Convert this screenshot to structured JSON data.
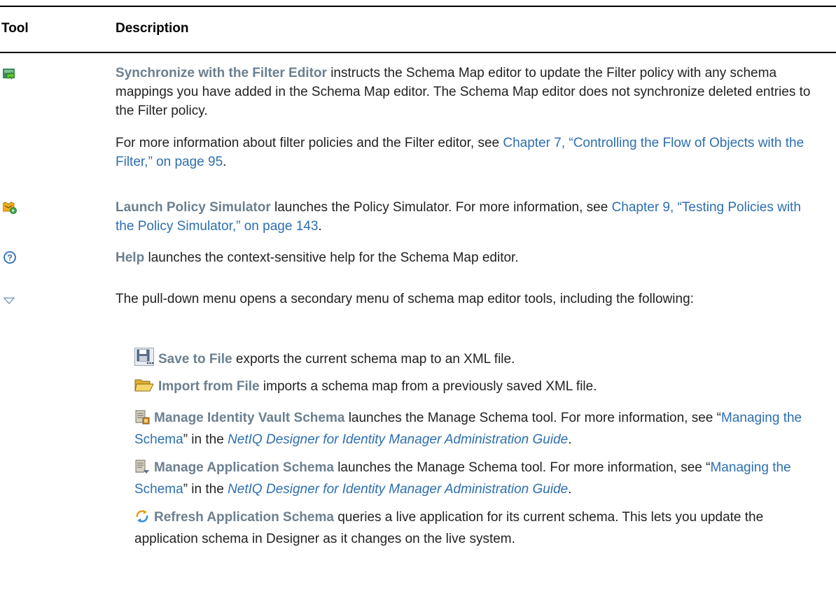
{
  "table": {
    "col_tool": "Tool",
    "col_description": "Description"
  },
  "rows": {
    "sync": {
      "term": "Synchronize with the Filter Editor",
      "text_a": " instructs the Schema Map editor to update the Filter policy with any schema mappings you have added in the Schema Map editor. The Schema Map editor does not synchronize deleted entries to the Filter policy.",
      "more_a": "For more information about filter policies and the Filter editor, see ",
      "more_link": "Chapter 7, “Controlling the Flow of Objects with the Filter,” on page 95",
      "more_b": "."
    },
    "simulator": {
      "term": "Launch Policy Simulator",
      "text_a": " launches the Policy Simulator. For more information, see ",
      "link": "Chapter 9, “Testing Policies with the Policy Simulator,” on page 143",
      "text_b": "."
    },
    "help": {
      "term": "Help",
      "text_a": " launches the context-sensitive help for the Schema Map editor."
    },
    "pulldown": {
      "text_a": "The pull-down menu opens a secondary menu of schema map editor tools, including the following:"
    }
  },
  "submenu": {
    "save": {
      "term": "Save to File",
      "text_a": " exports the current schema map to an XML file."
    },
    "import": {
      "term": "Import from File",
      "text_a": " imports a schema map from a previously saved XML file."
    },
    "manage_vault": {
      "term": "Manage Identity Vault Schema",
      "text_a": " launches the Manage Schema tool. For more information, see “",
      "link": "Managing the Schema",
      "text_b": "” in the ",
      "doc": "NetIQ Designer for Identity Manager Administration Guide",
      "text_c": "."
    },
    "manage_app": {
      "term": "Manage Application Schema",
      "text_a": " launches the Manage Schema tool. For more information, see “",
      "link": "Managing the Schema",
      "text_b": "” in the ",
      "doc": "NetIQ Designer for Identity Manager Administration Guide",
      "text_c": "."
    },
    "refresh": {
      "term": "Refresh Application Schema",
      "text_a": " queries a live application for its current schema. This lets you update the application schema in Designer as it changes on the live system."
    }
  }
}
